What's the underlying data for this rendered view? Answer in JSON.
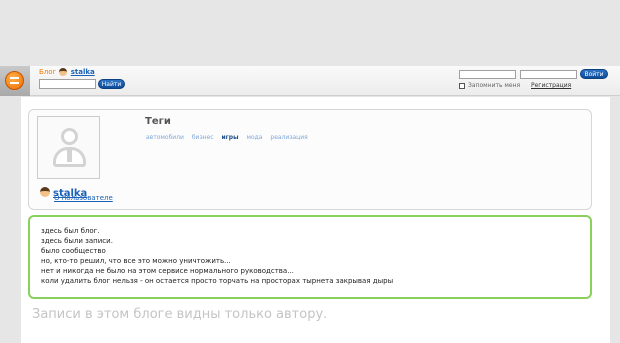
{
  "header": {
    "blog_label": "Блог",
    "blog_user": "stalka",
    "search_button": "Найти",
    "login_button": "Войти",
    "remember_label": "Запомнить меня",
    "register_link": "Регистрация"
  },
  "profile": {
    "name": "stalka",
    "about_link": "О пользователе"
  },
  "tags": {
    "title": "Теги",
    "items": [
      "автомобили",
      "бизнес",
      "игры",
      "мода",
      "реализация"
    ]
  },
  "message": {
    "lines": [
      "здесь был блог.",
      "здесь были записи.",
      "было сообщество",
      "но, кто-то решил, что все это можно уничтожить...",
      "нет и никогда не было на этом сервисе нормального руководства...",
      "коли удалить блог нельзя - он остается просто торчать на просторах тырнета закрывая дыры"
    ]
  },
  "notice": "Записи в этом блоге видны только автору."
}
